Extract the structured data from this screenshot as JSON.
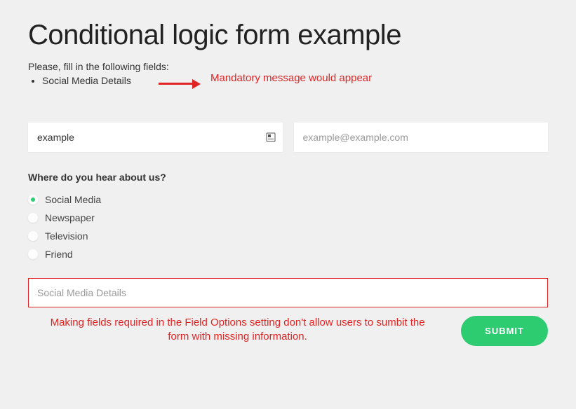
{
  "title": "Conditional logic form example",
  "instruction": "Please, fill in the following fields:",
  "required_item": "Social Media Details",
  "annotation_top": "Mandatory message would appear",
  "name_field": {
    "value": "example"
  },
  "email_field": {
    "placeholder": "example@example.com"
  },
  "question": "Where do you hear about us?",
  "options": {
    "o0": "Social Media",
    "o1": "Newspaper",
    "o2": "Television",
    "o3": "Friend"
  },
  "selected_option": "Social Media",
  "details_field": {
    "placeholder": "Social Media Details"
  },
  "annotation_bottom": "Making fields required in the Field Options setting don't allow users to sumbit the form with missing information.",
  "submit_label": "SUBMIT",
  "colors": {
    "accent": "#2ecc71",
    "error": "#e02424"
  }
}
